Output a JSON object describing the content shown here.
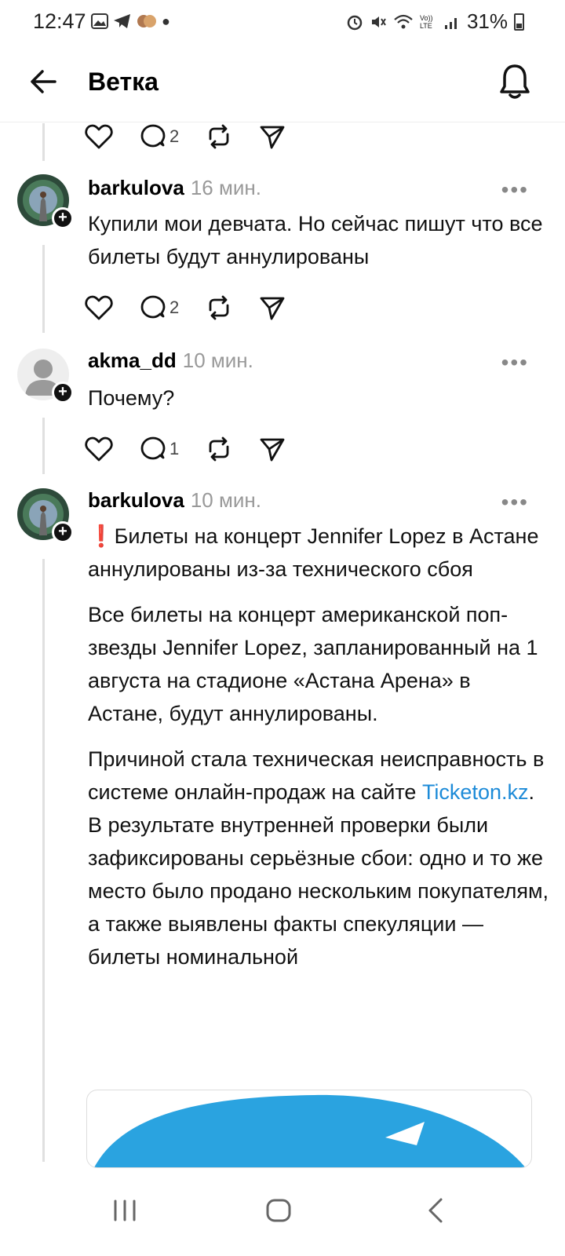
{
  "status_bar": {
    "time": "12:47",
    "battery": "31%",
    "network_label": "Vo)) LTE"
  },
  "header": {
    "title": "Ветка"
  },
  "posts": [
    {
      "username": "",
      "time": "",
      "text": [],
      "likes": "",
      "replies": "2"
    },
    {
      "username": "barkulova",
      "time": "16 мин.",
      "text": [
        "Купили мои девчата. Но сейчас пишут что все билеты будут аннулированы"
      ],
      "replies": "2"
    },
    {
      "username": "akma_dd",
      "time": "10 мин.",
      "text": [
        "Почему?"
      ],
      "replies": "1"
    },
    {
      "username": "barkulova",
      "time": "10 мин.",
      "text": [
        "❗Билеты на концерт Jennifer Lopez в Астане аннулированы из-за технического сбоя",
        "Все билеты на концерт американской поп-звезды Jennifer Lopez, запланированный на 1 августа на стадионе «Астана Арена» в Астане, будут аннулированы."
      ],
      "para3_before": "Причиной стала техническая неисправность в системе онлайн-продаж на сайте ",
      "para3_link": "Ticketon.kz",
      "para3_after": ". В результате внутренней проверки были зафиксированы серьёзные сбои: одно и то же место было продано нескольким покупателям, а также выявлены факты спекуляции — билеты номинальной"
    }
  ],
  "more_label": "•••",
  "colors": {
    "link": "#1d8bd8",
    "muted": "#999999",
    "image_blue": "#2aa3e0"
  }
}
